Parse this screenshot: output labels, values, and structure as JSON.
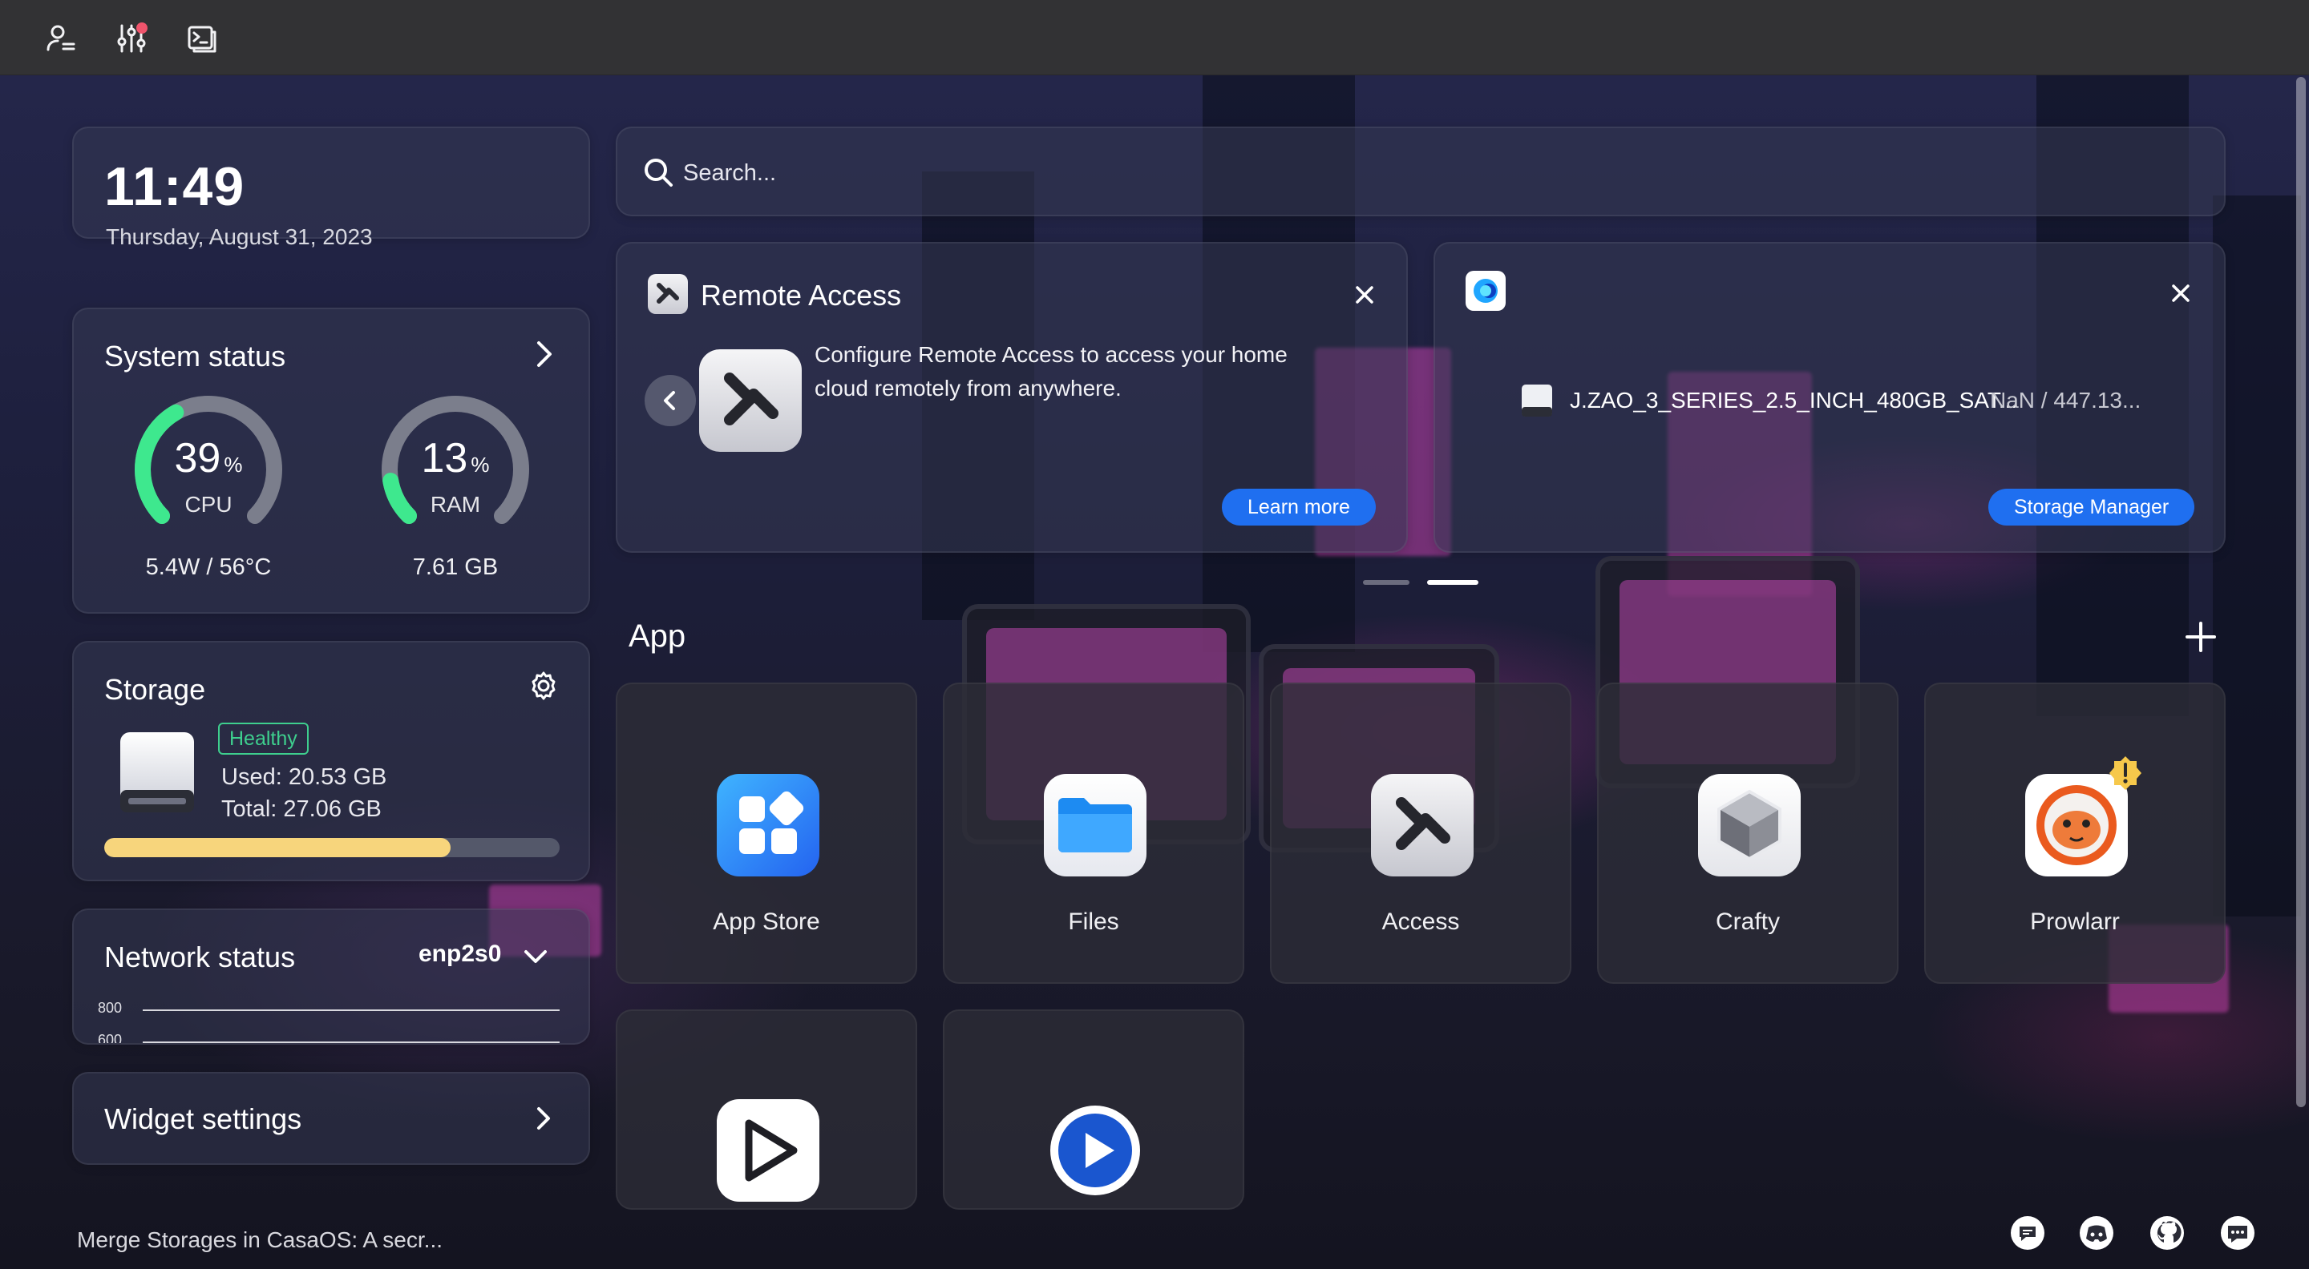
{
  "topbar": {
    "icons": [
      "account-icon",
      "settings-sliders-icon",
      "terminal-icon"
    ]
  },
  "clock": {
    "time": "11:49",
    "date": "Thursday, August 31, 2023"
  },
  "system_status": {
    "title": "System status",
    "cpu": {
      "value": "39",
      "unit": "%",
      "label": "CPU",
      "detail": "5.4W / 56°C",
      "fraction": 0.39
    },
    "ram": {
      "value": "13",
      "unit": "%",
      "label": "RAM",
      "detail": "7.61 GB",
      "fraction": 0.13
    }
  },
  "storage": {
    "title": "Storage",
    "health": "Healthy",
    "used": "Used: 20.53 GB",
    "total": "Total: 27.06 GB",
    "used_fraction": 0.76
  },
  "network": {
    "title": "Network status",
    "interface": "enp2s0",
    "axis": [
      "800",
      "600"
    ]
  },
  "widget_settings": {
    "title": "Widget settings"
  },
  "search": {
    "placeholder": "Search..."
  },
  "remote_access": {
    "title": "Remote Access",
    "description": "Configure Remote Access to access your home cloud remotely from anywhere.",
    "button": "Learn more"
  },
  "storage_card": {
    "disk_name": "J.ZAO_3_SERIES_2.5_INCH_480GB_SAT...",
    "disk_usage": "NaN / 447.13...",
    "button": "Storage Manager"
  },
  "apps": {
    "title": "App",
    "items": [
      {
        "label": "App Store"
      },
      {
        "label": "Files"
      },
      {
        "label": "Access"
      },
      {
        "label": "Crafty"
      },
      {
        "label": "Prowlarr"
      },
      {
        "label": ""
      },
      {
        "label": ""
      }
    ]
  },
  "footer": {
    "news": "Merge Storages in CasaOS: A secr..."
  },
  "colors": {
    "accent": "#1f6ff0",
    "gauge": "#3ee88e",
    "storage_bar": "#f7d57c",
    "healthy": "#3ecf8e"
  }
}
